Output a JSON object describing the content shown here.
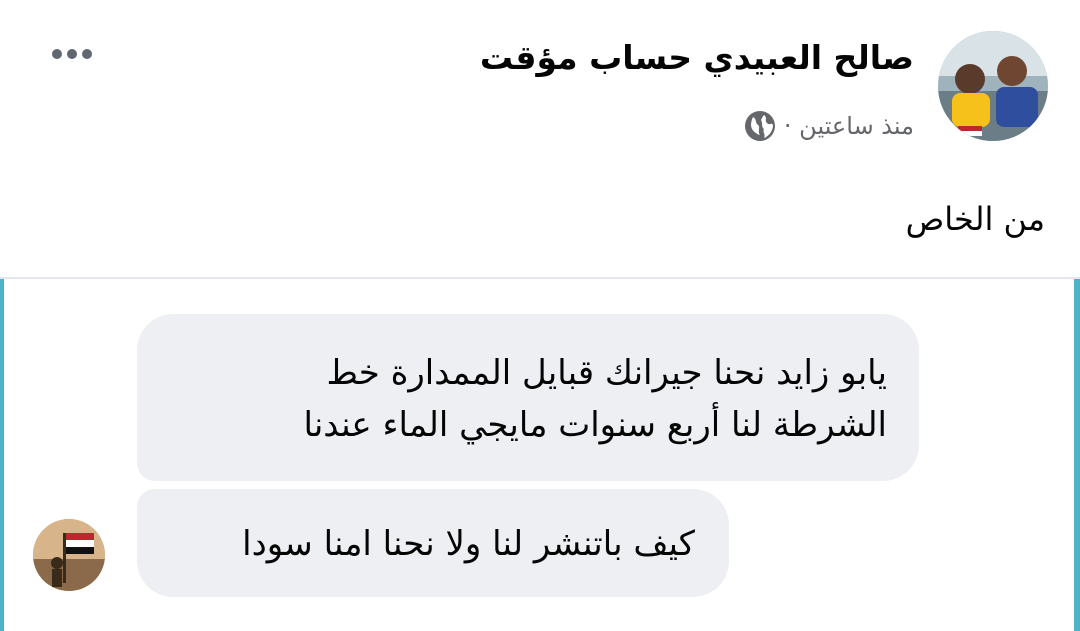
{
  "post": {
    "author": "صالح العبيدي حساب مؤقت",
    "time": "منذ ساعتين ·",
    "privacy_icon": "globe-icon",
    "text": "من الخاص"
  },
  "conversation": {
    "messages": [
      {
        "lines": [
          "يابو زايد نحنا جيرانك قبايل الممدارة خط",
          "الشرطة لنا أربع سنوات مايجي الماء عندنا"
        ]
      },
      {
        "lines": [
          "كيف باتنشر لنا ولا نحنا امنا سودا"
        ]
      }
    ]
  },
  "colors": {
    "bubble": "#eeeff2",
    "accent_bar": "#4fb3c8",
    "meta_text": "#65676b"
  }
}
